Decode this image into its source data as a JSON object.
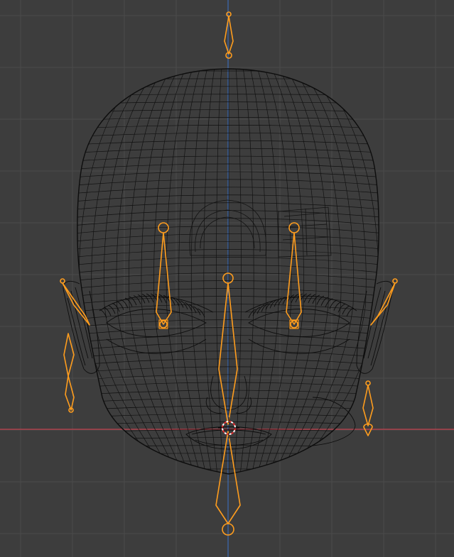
{
  "viewport": {
    "view": "front-orthographic",
    "shading": "wireframe",
    "mode": "pose",
    "colors": {
      "background": "#3d3d3d",
      "grid": "#4a4a4a",
      "axis_x": "#c4404d",
      "axis_z": "#3d6bb3",
      "wire": "#0d0d0d",
      "bone_selected": "#ff9d1e",
      "bone_active": "#ffcc6a",
      "cursor_red": "#e0282a",
      "cursor_white": "#ffffff"
    }
  },
  "objects": {
    "mesh": {
      "name": "head-mesh",
      "shading": "wireframe"
    },
    "armature": {
      "bones": [
        {
          "id": "head-top",
          "selected": true
        },
        {
          "id": "eye-left",
          "selected": true
        },
        {
          "id": "eye-right",
          "selected": true
        },
        {
          "id": "nose",
          "selected": true
        },
        {
          "id": "jaw",
          "selected": true
        },
        {
          "id": "ear-left-chain",
          "selected": true
        },
        {
          "id": "ear-right-chain",
          "selected": true
        }
      ]
    }
  },
  "cursor_3d": {
    "visible": true
  }
}
